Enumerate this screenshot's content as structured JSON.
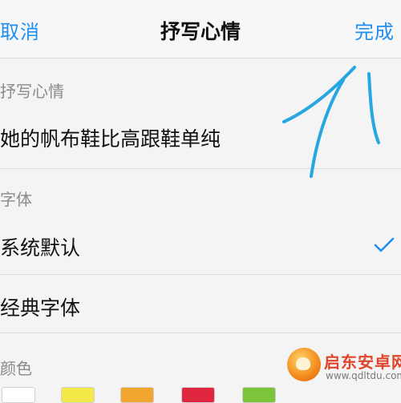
{
  "header": {
    "cancel_label": "取消",
    "title": "抒写心情",
    "done_label": "完成"
  },
  "mood_section": {
    "label": "抒写心情",
    "text": "她的帆布鞋比高跟鞋单纯"
  },
  "font_section": {
    "label": "字体",
    "options": [
      {
        "label": "系统默认",
        "selected": true
      },
      {
        "label": "经典字体",
        "selected": false
      }
    ]
  },
  "color_section": {
    "label": "颜色",
    "swatches": [
      "#ffffff",
      "#f5e94a",
      "#f0a531",
      "#e0273f",
      "#7cc43a"
    ]
  },
  "accent_color": "#1e8ff0",
  "watermark": {
    "title": "启东安卓网",
    "url": "www.qdltdu.com"
  }
}
